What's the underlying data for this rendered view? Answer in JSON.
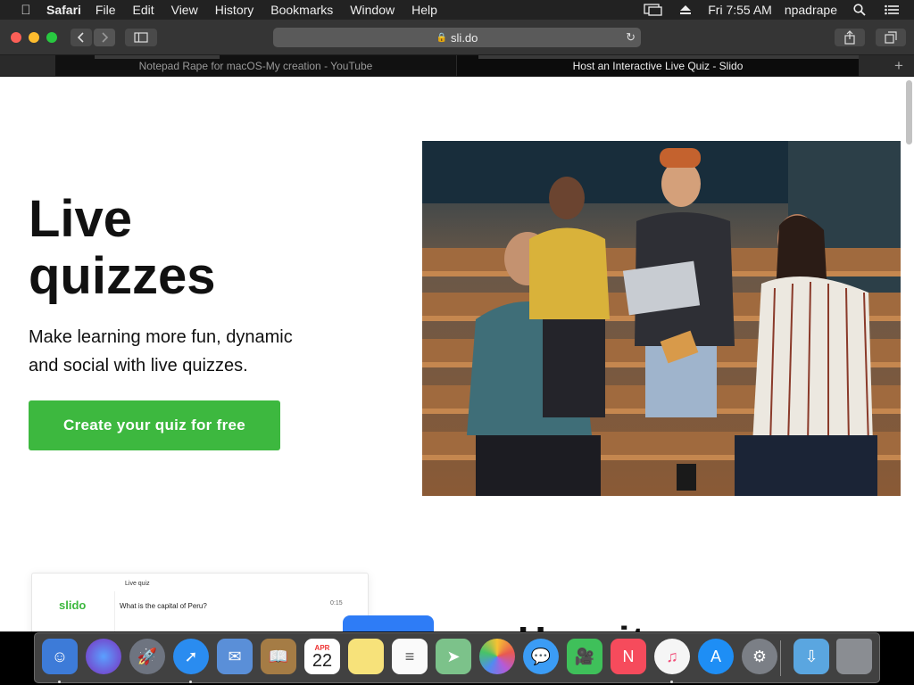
{
  "menubar": {
    "apple_icon": "apple-logo-icon",
    "app_name": "Safari",
    "menus": [
      "File",
      "Edit",
      "View",
      "History",
      "Bookmarks",
      "Window",
      "Help"
    ],
    "clock": "Fri 7:55 AM",
    "user": "npadrape",
    "status_icons": [
      "display-mirroring-icon",
      "eject-icon",
      "spotlight-search-icon",
      "notification-center-icon"
    ]
  },
  "browser": {
    "url": "sli.do",
    "tabs": [
      {
        "title": "Notepad Rape for macOS-My creation - YouTube",
        "active": false
      },
      {
        "title": "Host an Interactive Live Quiz - Slido",
        "active": true
      }
    ],
    "buttons": {
      "back": "back-icon",
      "forward": "forward-icon",
      "sidebar": "sidebar-icon",
      "reload": "reload-icon",
      "share": "share-icon",
      "tab_overview": "tab-overview-icon",
      "new_tab": "plus-icon"
    }
  },
  "page": {
    "hero": {
      "title_line1": "Live",
      "title_line2": "quizzes",
      "subtitle": "Make learning more fun, dynamic and social with live quizzes.",
      "cta_label": "Create your quiz for free"
    },
    "quiz_card": {
      "logo": "slido",
      "kicker": "Live quiz",
      "question": "What is the capital of Peru?",
      "meta": "0:15"
    },
    "next_section_peek": "How it work"
  },
  "colors": {
    "brand_green": "#3db83f",
    "menubar_bg": "#222222",
    "toolbar_bg": "#353535"
  },
  "dock": {
    "apps": [
      "Finder",
      "Siri",
      "Launchpad",
      "Safari",
      "Mail",
      "Contacts",
      "Calendar",
      "Notes",
      "Reminders",
      "Maps",
      "Photos",
      "Messages",
      "FaceTime",
      "News",
      "iTunes",
      "App Store",
      "System Preferences",
      "Downloads",
      "Trash"
    ],
    "calendar_month": "APR",
    "calendar_day": "22"
  }
}
